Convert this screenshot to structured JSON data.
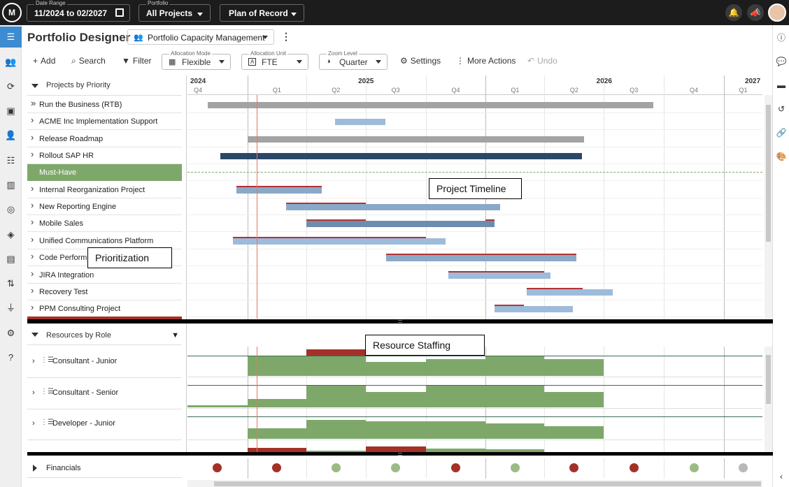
{
  "topbar": {
    "logo": "M",
    "date_range": {
      "label": "Date Range",
      "value": "11/2024 to 02/2027"
    },
    "portfolio": {
      "label": "Portfolio",
      "value": "All Projects"
    },
    "plan": {
      "value": "Plan of Record"
    },
    "icons": [
      "bell-icon",
      "megaphone-icon"
    ]
  },
  "header": {
    "title": "Portfolio Designer",
    "view": "Portfolio Capacity Management"
  },
  "toolbar": {
    "add": "Add",
    "search": "Search",
    "filter": "Filter",
    "allocation_mode": {
      "label": "Allocation Mode",
      "value": "Flexible"
    },
    "allocation_unit": {
      "label": "Allocation Unit",
      "value": "FTE"
    },
    "zoom_level": {
      "label": "Zoom Level",
      "value": "Quarter"
    },
    "settings": "Settings",
    "more_actions": "More Actions",
    "undo": "Undo"
  },
  "projects_panel": {
    "header": "Projects by Priority",
    "rows": [
      {
        "name": "Run the Business (RTB)",
        "expander": "double"
      },
      {
        "name": "ACME Inc Implementation Support",
        "expander": "single"
      },
      {
        "name": "Release Roadmap",
        "expander": "single"
      },
      {
        "name": "Rollout SAP HR",
        "expander": "single"
      },
      {
        "name": "Must-Have",
        "expander": "none"
      },
      {
        "name": "Internal Reorganization Project",
        "expander": "single"
      },
      {
        "name": "New Reporting Engine",
        "expander": "single"
      },
      {
        "name": "Mobile Sales",
        "expander": "single"
      },
      {
        "name": "Unified Communications Platform",
        "expander": "single"
      },
      {
        "name": "Code Performa",
        "expander": "single"
      },
      {
        "name": "JIRA Integration",
        "expander": "single"
      },
      {
        "name": "Recovery Test",
        "expander": "single"
      },
      {
        "name": "PPM Consulting Project",
        "expander": "single"
      }
    ]
  },
  "timeline": {
    "years": [
      {
        "label": "2024",
        "quarters": [
          "Q4"
        ]
      },
      {
        "label": "2025",
        "quarters": [
          "Q1",
          "Q2",
          "Q3",
          "Q4"
        ]
      },
      {
        "label": "2026",
        "quarters": [
          "Q1",
          "Q2",
          "Q3",
          "Q4"
        ]
      },
      {
        "label": "2027",
        "quarters": [
          "Q1"
        ]
      }
    ],
    "today_marker": "2025-01-15",
    "colors": {
      "grey": "#a3a3a3",
      "light_blue": "#9dbbda",
      "steel_blue": "#8aa9c9",
      "navy": "#2b4768",
      "mid_blue": "#6d8db0",
      "red_line": "#b33333",
      "must_have": "#7ea86a"
    },
    "bars": [
      {
        "start": "2024-11-01",
        "end": "2026-09-15",
        "color": "grey",
        "overlay": null
      },
      {
        "start": "2025-05-15",
        "end": "2025-07-31",
        "color": "light_blue",
        "overlay": null
      },
      {
        "start": "2025-01-01",
        "end": "2026-06-01",
        "color": "grey",
        "overlay": null
      },
      {
        "start": "2024-11-20",
        "end": "2026-05-28",
        "color": "navy",
        "overlay": null
      },
      null,
      {
        "start": "2024-12-15",
        "end": "2025-04-25",
        "color": "steel_blue",
        "overlay": [
          {
            "start": "2024-12-15",
            "end": "2025-04-25"
          }
        ]
      },
      {
        "start": "2025-03-01",
        "end": "2026-01-23",
        "color": "steel_blue",
        "overlay": [
          {
            "start": "2025-03-01",
            "end": "2025-07-01"
          }
        ]
      },
      {
        "start": "2025-04-01",
        "end": "2026-01-15",
        "color": "mid_blue",
        "overlay": [
          {
            "start": "2025-04-01",
            "end": "2025-07-01"
          },
          {
            "start": "2026-01-01",
            "end": "2026-01-15"
          }
        ]
      },
      {
        "start": "2024-12-10",
        "end": "2025-11-01",
        "color": "light_blue",
        "overlay": [
          {
            "start": "2024-12-10",
            "end": "2025-10-01"
          }
        ]
      },
      {
        "start": "2025-08-01",
        "end": "2026-05-20",
        "color": "steel_blue",
        "overlay": [
          {
            "start": "2025-08-01",
            "end": "2026-05-20"
          }
        ]
      },
      {
        "start": "2025-11-05",
        "end": "2026-04-10",
        "color": "light_blue",
        "overlay": [
          {
            "start": "2025-11-05",
            "end": "2026-04-01"
          }
        ]
      },
      {
        "start": "2026-03-05",
        "end": "2026-07-15",
        "color": "light_blue",
        "overlay": [
          {
            "start": "2026-03-05",
            "end": "2026-05-30"
          }
        ]
      },
      {
        "start": "2026-01-15",
        "end": "2026-05-15",
        "color": "light_blue",
        "overlay": [
          {
            "start": "2026-01-15",
            "end": "2026-03-01"
          }
        ]
      }
    ],
    "callouts": {
      "timeline": "Project Timeline",
      "prioritization": "Prioritization",
      "staffing": "Resource Staffing"
    }
  },
  "resources_panel": {
    "header": "Resources by Role",
    "roles": [
      {
        "name": "Consultant - Junior"
      },
      {
        "name": "Consultant - Senior"
      },
      {
        "name": "Developer - Junior"
      }
    ]
  },
  "financials": {
    "label": "Financials",
    "dots": [
      "red",
      "red",
      "green",
      "green",
      "red",
      "green",
      "red",
      "red",
      "green",
      "grey"
    ],
    "colors": {
      "red": "#a33128",
      "green": "#9bbb84",
      "grey": "#b8b8b8"
    }
  }
}
